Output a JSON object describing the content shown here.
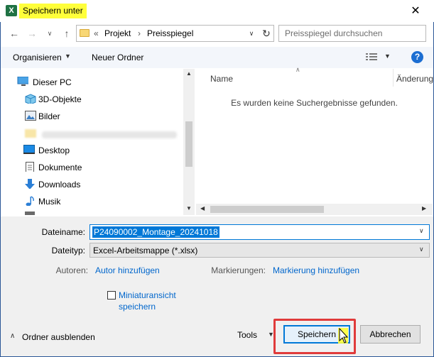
{
  "window": {
    "title": "Speichern unter",
    "app_icon_letter": "X",
    "close_glyph": "✕"
  },
  "address": {
    "prefix": "«",
    "crumbs": [
      "Projekt",
      "Preisspiegel"
    ],
    "separator": "›"
  },
  "search": {
    "placeholder": "Preisspiegel durchsuchen"
  },
  "toolbar": {
    "organize_label": "Organisieren",
    "new_folder_label": "Neuer Ordner",
    "help_glyph": "?"
  },
  "tree": {
    "items": [
      {
        "label": "Dieser PC",
        "icon": "computer-icon"
      },
      {
        "label": "3D-Objekte",
        "icon": "cube-icon"
      },
      {
        "label": "Bilder",
        "icon": "pictures-icon"
      },
      {
        "label": "",
        "icon": "folder-icon"
      },
      {
        "label": "Desktop",
        "icon": "desktop-icon"
      },
      {
        "label": "Dokumente",
        "icon": "documents-icon"
      },
      {
        "label": "Downloads",
        "icon": "download-icon"
      },
      {
        "label": "Musik",
        "icon": "music-icon"
      }
    ]
  },
  "list": {
    "col_name": "Name",
    "col_changed": "Änderung",
    "empty_message": "Es wurden keine Suchergebnisse gefunden."
  },
  "form": {
    "filename_label": "Dateiname:",
    "filename_value": "P24090002_Montage_20241018",
    "filetype_label": "Dateityp:",
    "filetype_value": "Excel-Arbeitsmappe (*.xlsx)",
    "authors_label": "Autoren:",
    "authors_link": "Autor hinzufügen",
    "tags_label": "Markierungen:",
    "tags_link": "Markierung hinzufügen",
    "thumbnail_line1": "Miniaturansicht",
    "thumbnail_line2": "speichern",
    "thumbnail_checked": false
  },
  "footer": {
    "hide_folders_label": "Ordner ausblenden",
    "tools_label": "Tools",
    "save_label": "Speichern",
    "cancel_label": "Abbrechen"
  },
  "colors": {
    "highlight_yellow": "#ffff3a",
    "accent_blue": "#0078d7",
    "annotation_red": "#e03b3b",
    "excel_green": "#1f7244"
  }
}
